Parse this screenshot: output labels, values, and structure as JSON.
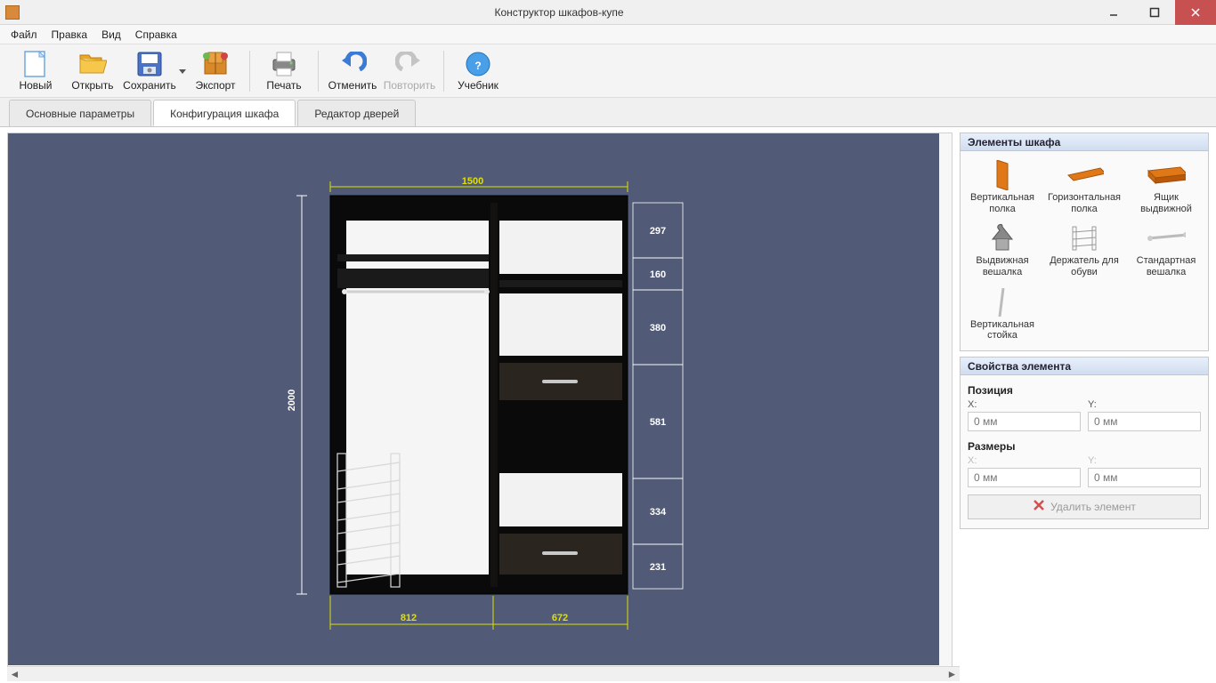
{
  "title": "Конструктор шкафов-купе",
  "menu": {
    "file": "Файл",
    "edit": "Правка",
    "view": "Вид",
    "help": "Справка"
  },
  "toolbar": {
    "new": "Новый",
    "open": "Открыть",
    "save": "Сохранить",
    "export": "Экспорт",
    "print": "Печать",
    "undo": "Отменить",
    "redo": "Повторить",
    "tutorial": "Учебник"
  },
  "tabs": {
    "t1": "Основные параметры",
    "t2": "Конфигурация шкафа",
    "t3": "Редактор дверей"
  },
  "dimensions": {
    "total_width": "1500",
    "total_height": "2000",
    "bottom_left": "812",
    "bottom_right": "672",
    "right": [
      "297",
      "160",
      "380",
      "581",
      "334",
      "231"
    ]
  },
  "panels": {
    "elements_title": "Элементы шкафа",
    "items": {
      "vshelf": "Вертикальная полка",
      "hshelf": "Горизонтальная полка",
      "drawer": "Ящик выдвижной",
      "pullhanger": "Выдвижная вешалка",
      "shoeholder": "Держатель для обуви",
      "stdhanger": "Стандартная вешалка",
      "vrack": "Вертикальная стойка"
    },
    "props_title": "Свойства элемента",
    "position_title": "Позиция",
    "size_title": "Размеры",
    "x": "X:",
    "y": "Y:",
    "placeholder": "0 мм",
    "delete": "Удалить элемент"
  }
}
